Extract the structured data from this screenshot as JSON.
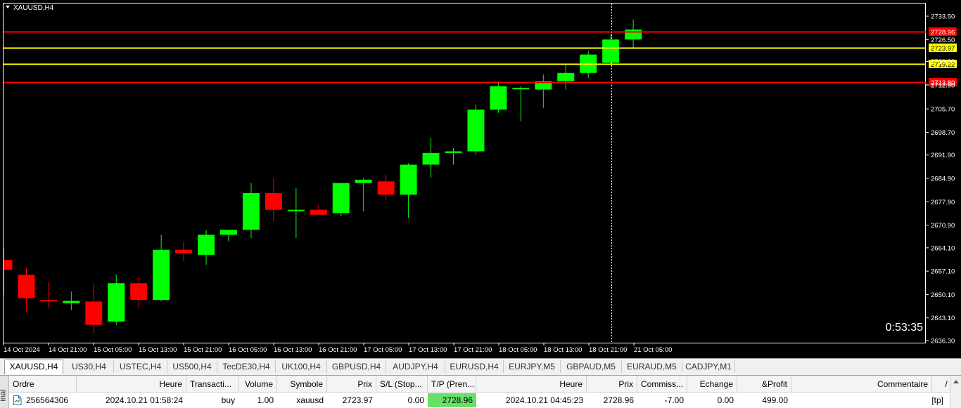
{
  "chart": {
    "symbol_label": "XAUUSD,H4",
    "countdown": "0:53:35",
    "colors": {
      "background": "#000000",
      "bull": "#00ff00",
      "bear": "#ff0000",
      "resistance": "#ff0000",
      "entry_line": "#ffff00",
      "text": "#ffffff",
      "axis": "#ffffff"
    },
    "price_axis_ticks": [
      "2733.50",
      "2726.50",
      "2719.90",
      "2712.90",
      "2705.70",
      "2698.70",
      "2691.90",
      "2684.90",
      "2677.90",
      "2670.90",
      "2664.10",
      "2657.10",
      "2650.10",
      "2643.10",
      "2636.30"
    ],
    "time_axis_labels": [
      "14 Oct 2024",
      "14 Oct 21:00",
      "15 Oct 05:00",
      "15 Oct 13:00",
      "15 Oct 21:00",
      "16 Oct 05:00",
      "16 Oct 13:00",
      "16 Oct 21:00",
      "17 Oct 05:00",
      "17 Oct 13:00",
      "17 Oct 21:00",
      "18 Oct 05:00",
      "18 Oct 13:00",
      "18 Oct 21:00",
      "21 Oct 05:00"
    ],
    "price_lines": [
      {
        "price": "2728.96",
        "color": "#ff0000",
        "label_color": "#ffffff"
      },
      {
        "price": "2723.97",
        "color": "#ffff00",
        "label_color": "#000000"
      },
      {
        "price": "2719.22",
        "color": "#ffff00",
        "label_color": "#000000"
      },
      {
        "price": "2713.80",
        "color": "#ff0000",
        "label_color": "#ffffff"
      }
    ],
    "candles": [
      {
        "open": 2660.5,
        "high": 2664,
        "low": 2650,
        "close": 2657.5
      },
      {
        "open": 2656,
        "high": 2658,
        "low": 2645,
        "close": 2649
      },
      {
        "open": 2648.5,
        "high": 2654,
        "low": 2646,
        "close": 2648.3
      },
      {
        "open": 2647.5,
        "high": 2651,
        "low": 2645.5,
        "close": 2648.2
      },
      {
        "open": 2648,
        "high": 2653.5,
        "low": 2638.5,
        "close": 2641
      },
      {
        "open": 2642,
        "high": 2656,
        "low": 2641,
        "close": 2653.5
      },
      {
        "open": 2653.5,
        "high": 2655.5,
        "low": 2646,
        "close": 2648.5
      },
      {
        "open": 2648.5,
        "high": 2668,
        "low": 2648,
        "close": 2663.5
      },
      {
        "open": 2663.5,
        "high": 2666,
        "low": 2660,
        "close": 2662.5
      },
      {
        "open": 2662,
        "high": 2669.5,
        "low": 2659,
        "close": 2668
      },
      {
        "open": 2668,
        "high": 2669.5,
        "low": 2666,
        "close": 2669.5
      },
      {
        "open": 2669.5,
        "high": 2683.5,
        "low": 2667,
        "close": 2680.5
      },
      {
        "open": 2680.5,
        "high": 2685,
        "low": 2672,
        "close": 2675.5
      },
      {
        "open": 2675.5,
        "high": 2682,
        "low": 2667,
        "close": 2675.5
      },
      {
        "open": 2675.5,
        "high": 2677,
        "low": 2674,
        "close": 2674
      },
      {
        "open": 2674.5,
        "high": 2683.5,
        "low": 2673.5,
        "close": 2683.5
      },
      {
        "open": 2683.5,
        "high": 2685,
        "low": 2675,
        "close": 2684.5
      },
      {
        "open": 2684,
        "high": 2686,
        "low": 2678.5,
        "close": 2680
      },
      {
        "open": 2680,
        "high": 2689.5,
        "low": 2673,
        "close": 2689
      },
      {
        "open": 2689,
        "high": 2697,
        "low": 2685,
        "close": 2692.5
      },
      {
        "open": 2692.5,
        "high": 2694,
        "low": 2689,
        "close": 2693
      },
      {
        "open": 2693,
        "high": 2707,
        "low": 2692,
        "close": 2705.5
      },
      {
        "open": 2705.5,
        "high": 2714,
        "low": 2704.5,
        "close": 2712.5
      },
      {
        "open": 2712,
        "high": 2712.5,
        "low": 2702,
        "close": 2712
      },
      {
        "open": 2711.5,
        "high": 2716,
        "low": 2706,
        "close": 2714
      },
      {
        "open": 2714,
        "high": 2719,
        "low": 2711.5,
        "close": 2716.5
      },
      {
        "open": 2716.5,
        "high": 2723,
        "low": 2715,
        "close": 2722
      },
      {
        "open": 2719.5,
        "high": 2728,
        "low": 2719,
        "close": 2726.5
      },
      {
        "open": 2726.5,
        "high": 2732.5,
        "low": 2724,
        "close": 2729.5
      }
    ]
  },
  "tabs": [
    {
      "label": "XAUUSD,H4",
      "active": true
    },
    {
      "label": "US30,H4"
    },
    {
      "label": "USTEC,H4"
    },
    {
      "label": "US500,H4"
    },
    {
      "label": "TecDE30,H4"
    },
    {
      "label": "UK100,H4"
    },
    {
      "label": "GBPUSD,H4"
    },
    {
      "label": "AUDJPY,H4"
    },
    {
      "label": "EURUSD,H4"
    },
    {
      "label": "EURJPY,M5"
    },
    {
      "label": "GBPAUD,M5"
    },
    {
      "label": "EURAUD,M5"
    },
    {
      "label": "CADJPY,M1"
    }
  ],
  "terminal": {
    "side_label": "inal",
    "headers": [
      "Ordre",
      "Heure",
      "Transacti...",
      "Volume",
      "Symbole",
      "Prix",
      "S/L (Stop...",
      "T/P (Pren...",
      "Heure",
      "Prix",
      "Commiss...",
      "Echange",
      "&Profit",
      "Commentaire"
    ],
    "sort_arrow": "/",
    "row": {
      "ordre": "256564306",
      "heure": "2024.10.21 01:58:24",
      "transaction": "buy",
      "volume": "1.00",
      "symbole": "xauusd",
      "prix": "2723.97",
      "sl": "0.00",
      "tp": "2728.96",
      "heure2": "2024.10.21 04:45:23",
      "prix2": "2728.96",
      "commission": "-7.00",
      "echange": "0.00",
      "profit": "499.00",
      "commentaire": "[tp]"
    }
  }
}
